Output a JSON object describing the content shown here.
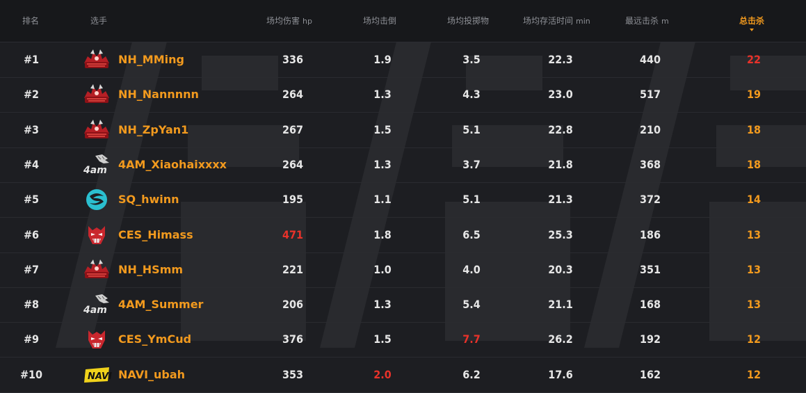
{
  "header": {
    "rank": "排名",
    "player": "选手",
    "damage": "场均伤害",
    "damage_unit": "hp",
    "knockdowns": "场均击倒",
    "throwables": "场均投掷物",
    "survival": "场均存活时间",
    "survival_unit": "min",
    "farthest": "最远击杀",
    "farthest_unit": "m",
    "kills": "总击杀"
  },
  "sorted_column": "kills",
  "colors": {
    "accent": "#f29a1e",
    "highlight_red": "#e8322a",
    "text": "#e6e6e6",
    "background": "#1d1e22"
  },
  "rows": [
    {
      "rank": "#1",
      "team": "NH",
      "team_icon": "nh-dragon-logo-icon",
      "player": "NH_MMing",
      "damage": "336",
      "knockdowns": "1.9",
      "throwables": "3.5",
      "survival": "22.3",
      "farthest": "440",
      "kills": "22",
      "red": [
        "kills"
      ]
    },
    {
      "rank": "#2",
      "team": "NH",
      "team_icon": "nh-dragon-logo-icon",
      "player": "NH_Nannnnn",
      "damage": "264",
      "knockdowns": "1.3",
      "throwables": "4.3",
      "survival": "23.0",
      "farthest": "517",
      "kills": "19",
      "red": []
    },
    {
      "rank": "#3",
      "team": "NH",
      "team_icon": "nh-dragon-logo-icon",
      "player": "NH_ZpYan1",
      "damage": "267",
      "knockdowns": "1.5",
      "throwables": "5.1",
      "survival": "22.8",
      "farthest": "210",
      "kills": "18",
      "red": []
    },
    {
      "rank": "#4",
      "team": "4AM",
      "team_icon": "4am-wolf-logo-icon",
      "player": "4AM_Xiaohaixxxx",
      "damage": "264",
      "knockdowns": "1.3",
      "throwables": "3.7",
      "survival": "21.8",
      "farthest": "368",
      "kills": "18",
      "red": []
    },
    {
      "rank": "#5",
      "team": "SQ",
      "team_icon": "sq-swirl-logo-icon",
      "player": "SQ_hwinn",
      "damage": "195",
      "knockdowns": "1.1",
      "throwables": "5.1",
      "survival": "21.3",
      "farthest": "372",
      "kills": "14",
      "red": []
    },
    {
      "rank": "#6",
      "team": "CES",
      "team_icon": "ces-demon-logo-icon",
      "player": "CES_Himass",
      "damage": "471",
      "knockdowns": "1.8",
      "throwables": "6.5",
      "survival": "25.3",
      "farthest": "186",
      "kills": "13",
      "red": [
        "damage"
      ]
    },
    {
      "rank": "#7",
      "team": "NH",
      "team_icon": "nh-dragon-logo-icon",
      "player": "NH_HSmm",
      "damage": "221",
      "knockdowns": "1.0",
      "throwables": "4.0",
      "survival": "20.3",
      "farthest": "351",
      "kills": "13",
      "red": []
    },
    {
      "rank": "#8",
      "team": "4AM",
      "team_icon": "4am-wolf-logo-icon",
      "player": "4AM_Summer",
      "damage": "206",
      "knockdowns": "1.3",
      "throwables": "5.4",
      "survival": "21.1",
      "farthest": "168",
      "kills": "13",
      "red": []
    },
    {
      "rank": "#9",
      "team": "CES",
      "team_icon": "ces-demon-logo-icon",
      "player": "CES_YmCud",
      "damage": "376",
      "knockdowns": "1.5",
      "throwables": "7.7",
      "survival": "26.2",
      "farthest": "192",
      "kills": "12",
      "red": [
        "throwables"
      ]
    },
    {
      "rank": "#10",
      "team": "NAVI",
      "team_icon": "navi-logo-icon",
      "player": "NAVI_ubah",
      "damage": "353",
      "knockdowns": "2.0",
      "throwables": "6.2",
      "survival": "17.6",
      "farthest": "162",
      "kills": "12",
      "red": [
        "knockdowns"
      ]
    }
  ]
}
